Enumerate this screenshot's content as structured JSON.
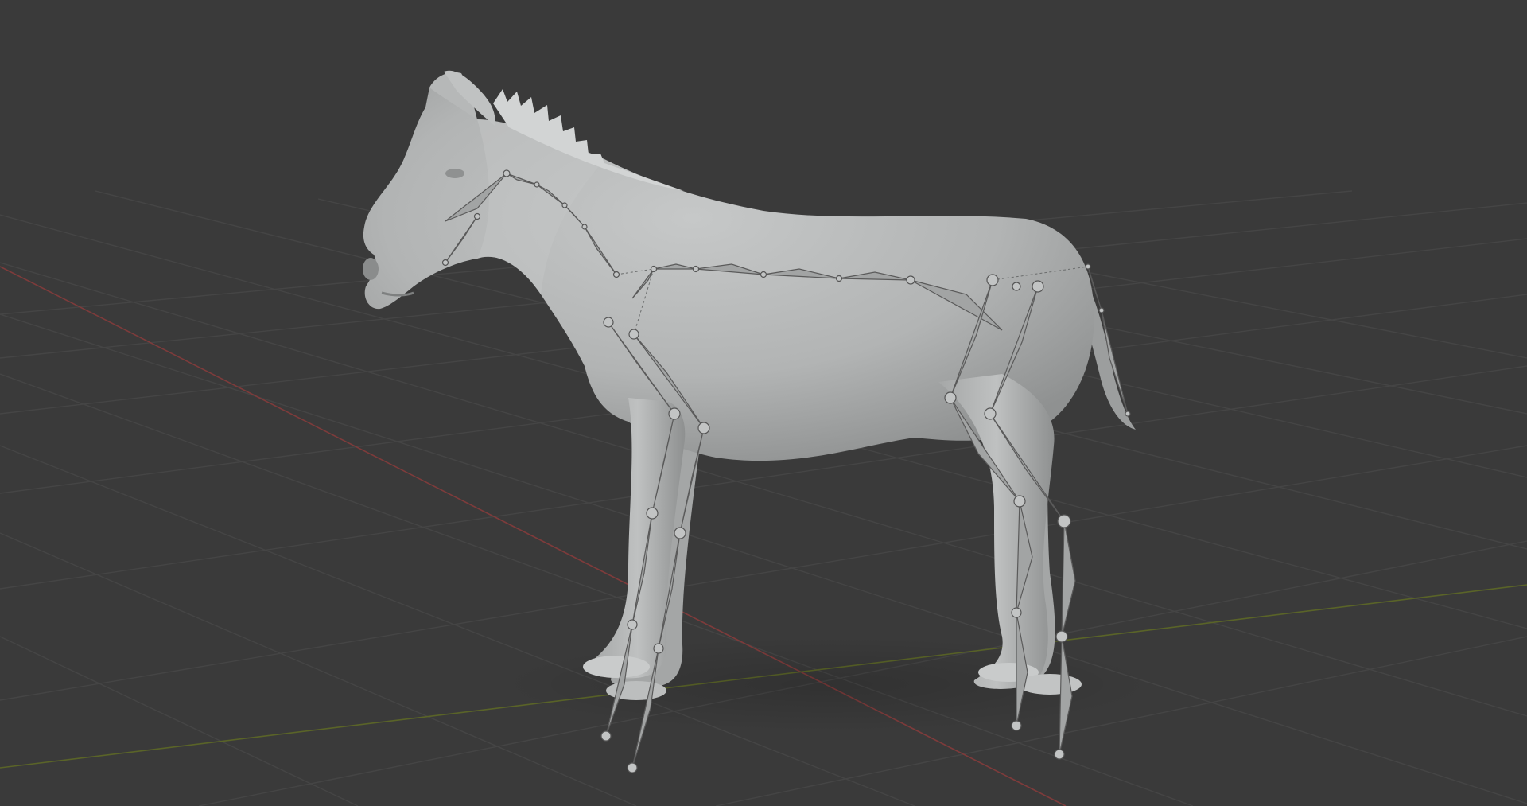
{
  "app": {
    "window_kind": "3D viewport",
    "background_color": "#3a3a3a",
    "grid_line_color": "#444444",
    "x_axis_color": "#8a3d3d",
    "y_axis_color": "#5f6b2a"
  },
  "scene": {
    "model": {
      "subject": "horse",
      "shading": "solid",
      "mesh_color": "#b3b5b5",
      "mane_color": "#d0d2d2"
    },
    "armature": {
      "display": "octahedral",
      "bone_color": "#9b9d9d",
      "joint_color": "#c2c4c4",
      "outline_color": "#555555"
    }
  }
}
